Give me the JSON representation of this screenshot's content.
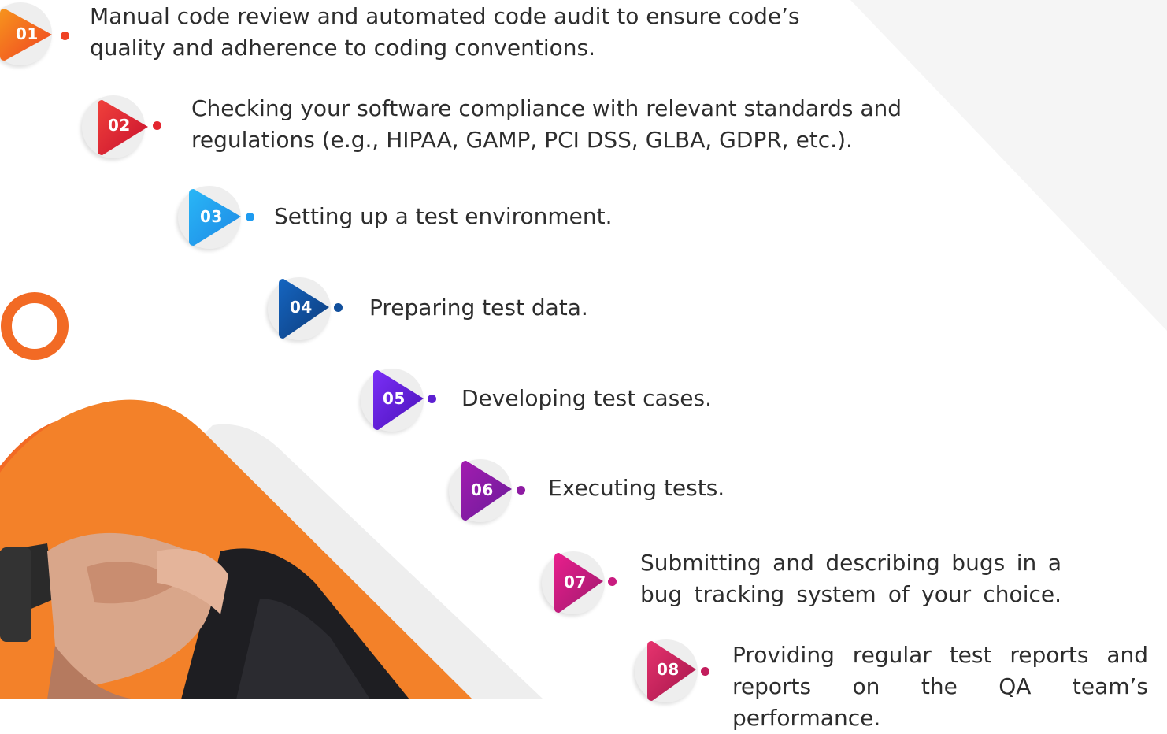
{
  "steps": [
    {
      "num": "01",
      "color_a": "#f7941d",
      "color_b": "#ef4123",
      "lines": [
        "Manual code review and automated code audit to ensure code’s",
        "quality and adherence to coding conventions."
      ]
    },
    {
      "num": "02",
      "color_a": "#f0413b",
      "color_b": "#c8102e",
      "lines": [
        "Checking your software compliance with relevant standards and",
        "regulations (e.g., HIPAA, GAMP, PCI DSS, GLBA, GDPR, etc.)."
      ]
    },
    {
      "num": "03",
      "color_a": "#29b6f6",
      "color_b": "#1e88e5",
      "lines": [
        "Setting up a test environment."
      ]
    },
    {
      "num": "04",
      "color_a": "#1565c0",
      "color_b": "#0d3b7a",
      "lines": [
        "Preparing test data."
      ]
    },
    {
      "num": "05",
      "color_a": "#7b2ff7",
      "color_b": "#4a12b8",
      "lines": [
        "Developing test cases."
      ]
    },
    {
      "num": "06",
      "color_a": "#a21caf",
      "color_b": "#6a1b9a",
      "lines": [
        "Executing tests."
      ]
    },
    {
      "num": "07",
      "color_a": "#e91e8c",
      "color_b": "#9c1a6e",
      "lines": [
        "Submitting and describing bugs in a",
        "bug tracking system of your choice."
      ]
    },
    {
      "num": "08",
      "color_a": "#e6336e",
      "color_b": "#a3154a",
      "lines": [
        "Providing regular test reports and",
        "reports on the QA team’s performance."
      ]
    }
  ],
  "colors": {
    "accent_orange": "#f26a24",
    "bg_gray": "#f4f4f4"
  }
}
